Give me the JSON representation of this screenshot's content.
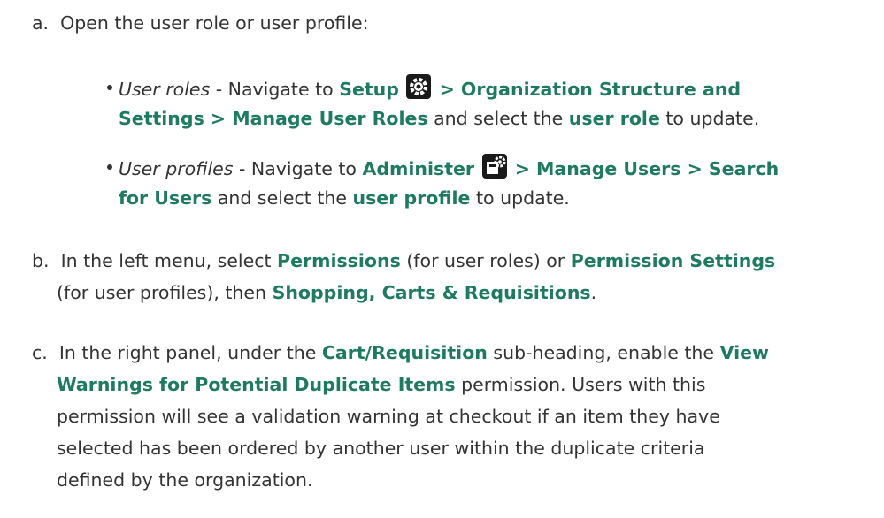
{
  "step_a": {
    "marker": "a.",
    "text": "Open the user role or user profile:",
    "bullet_roles": {
      "label": "User roles",
      "dash": " - Navigate to ",
      "b1": "Setup",
      "b2": " > Organization Structure and",
      "b3": "Settings > Manage User Roles",
      "t1": " and select the ",
      "b4": "user role",
      "t2": " to update.",
      "icon": "gear-icon"
    },
    "bullet_profiles": {
      "label": "User profiles",
      "dash": " - Navigate to ",
      "b1": "Administer",
      "b2": " > Manage Users > Search",
      "b3": "for Users",
      "t1": " and select the ",
      "b4": "user profile",
      "t2": " to update.",
      "icon": "admin-icon"
    }
  },
  "step_b": {
    "marker": "b.",
    "t1": "In the left menu, select ",
    "b1": "Permissions",
    "t2": " (for user roles) or ",
    "b2": "Permission Settings",
    "t3": "(for user profiles), then ",
    "b3": "Shopping, Carts & Requisitions",
    "t4": "."
  },
  "step_c": {
    "marker": "c.",
    "t1": "In the right panel, under the ",
    "b1": "Cart/Requisition",
    "t2": " sub-heading, enable the ",
    "b2": "View",
    "b3": "Warnings for Potential Duplicate Items",
    "t3": " permission. Users with this",
    "l3": "permission will see a validation warning at checkout if an item they have",
    "l4": "selected has been ordered by another user within the duplicate criteria",
    "l5": "defined by the organization."
  },
  "colors": {
    "bold": "#1f7a62",
    "text": "#333333"
  }
}
